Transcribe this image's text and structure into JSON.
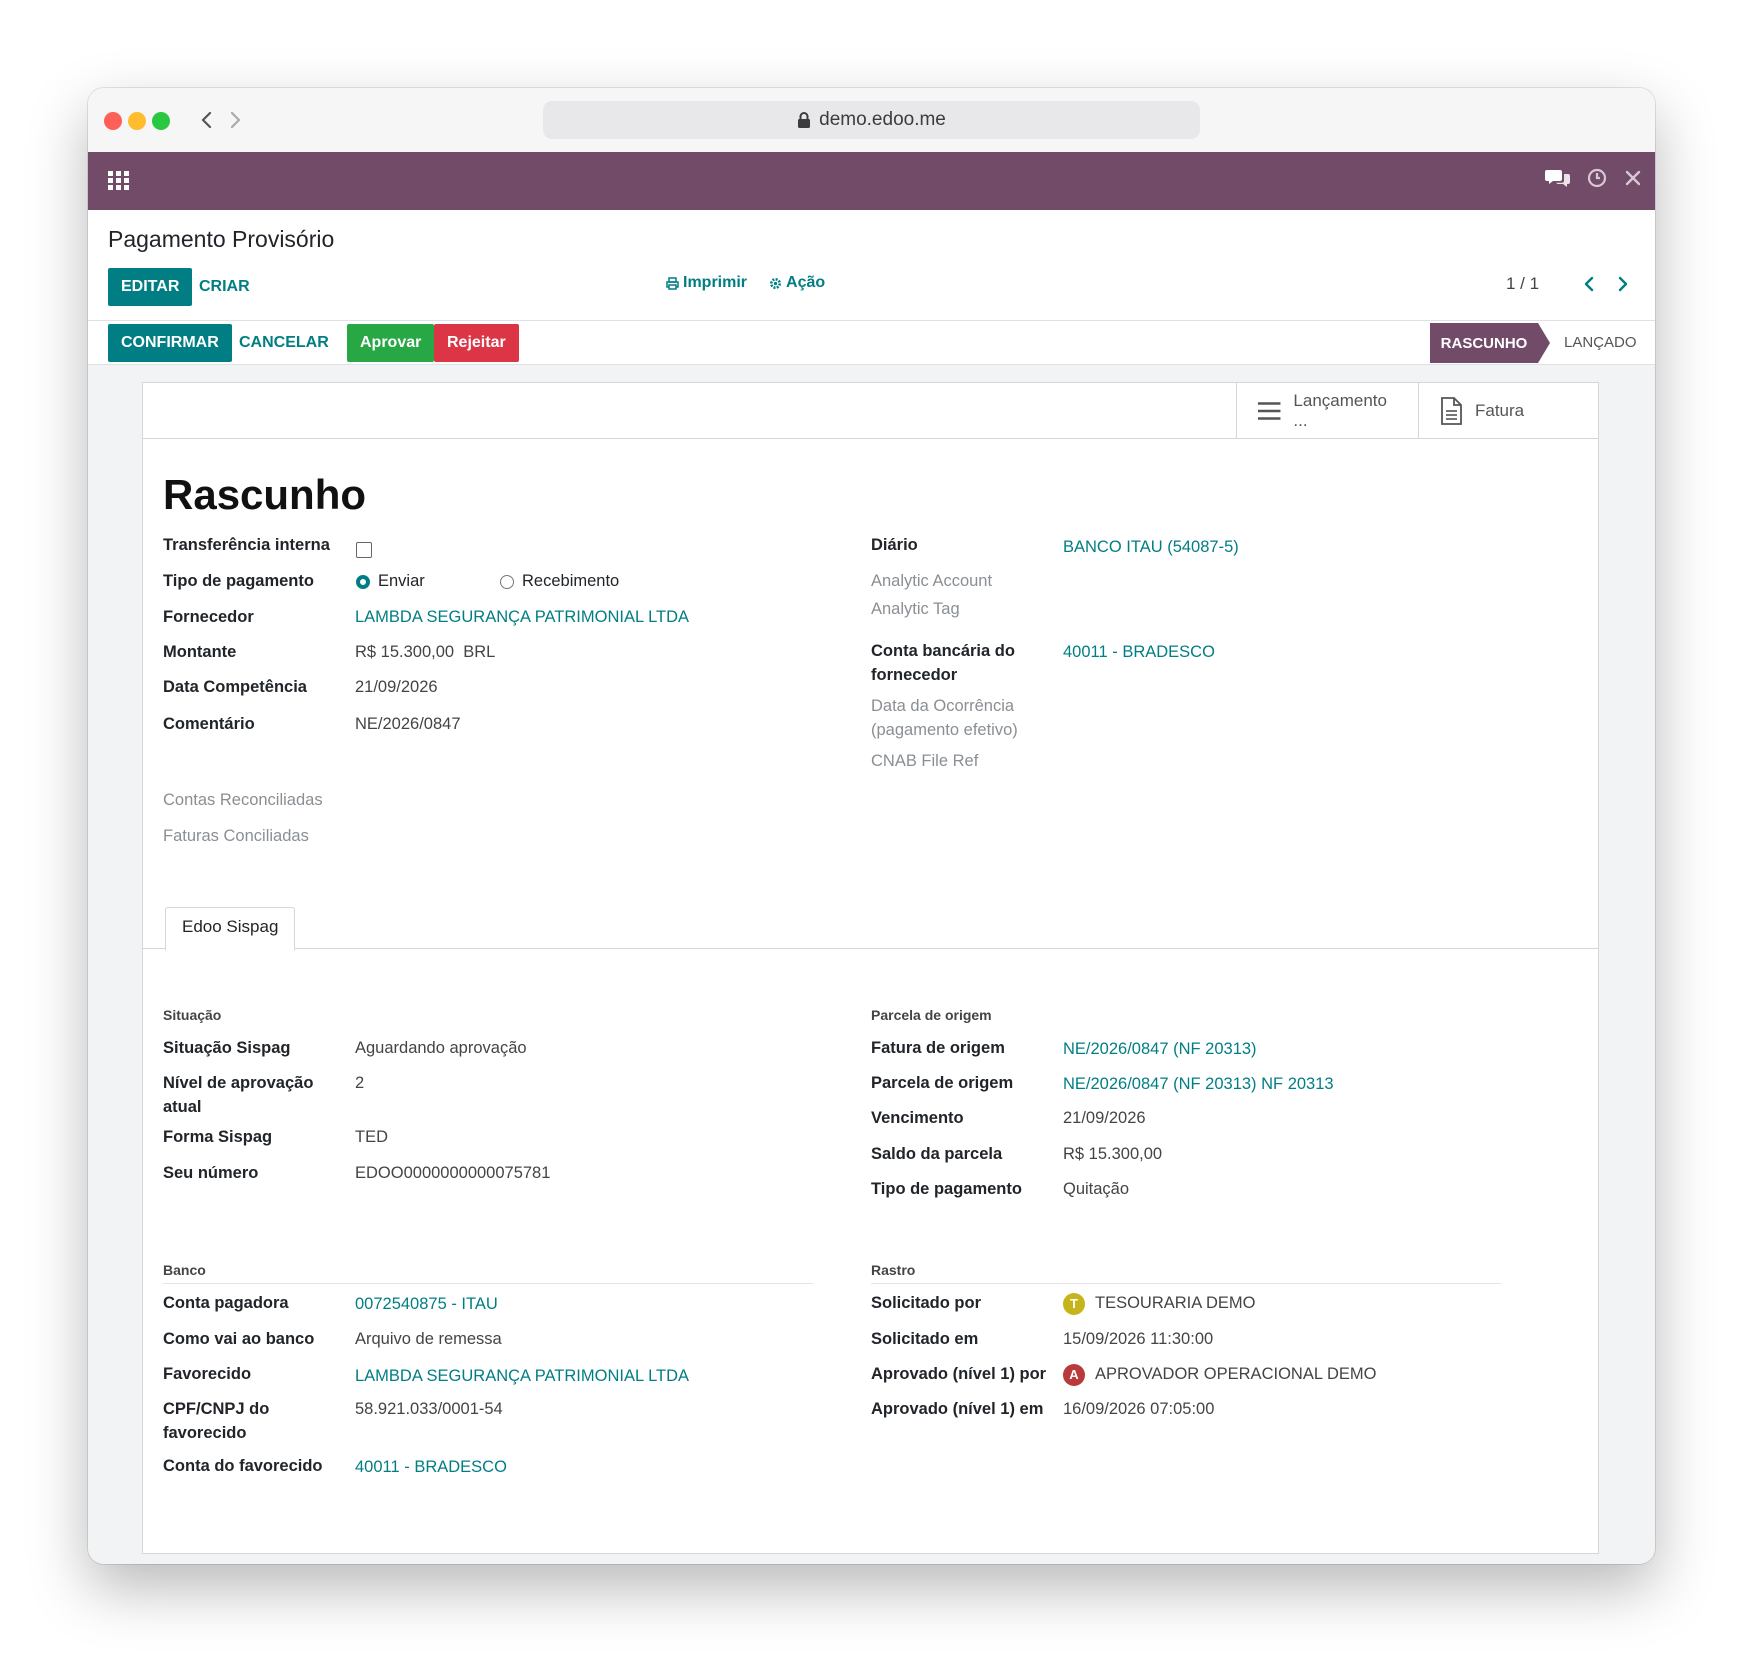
{
  "browser": {
    "url": "demo.edoo.me"
  },
  "app": {
    "breadcrumb": "Pagamento Provisório"
  },
  "toolbar": {
    "edit": "EDITAR",
    "create": "CRIAR",
    "print": "Imprimir",
    "action": "Ação",
    "pager": "1 / 1"
  },
  "header_buttons": {
    "confirm": "CONFIRMAR",
    "cancel": "CANCELAR",
    "approve": "Aprovar",
    "reject": "Rejeitar"
  },
  "statusbar": {
    "current": "RASCUNHO",
    "next": "LANÇADO"
  },
  "smart_buttons": {
    "journal_entry": "Lançamento ...",
    "invoice": "Fatura"
  },
  "form": {
    "state_title": "Rascunho",
    "left": {
      "internal_transfer_label": "Transferência interna",
      "internal_transfer_checked": false,
      "payment_type_label": "Tipo de pagamento",
      "payment_type_send": "Enviar",
      "payment_type_receive": "Recebimento",
      "payment_type_selected": "Enviar",
      "supplier_label": "Fornecedor",
      "supplier": "LAMBDA SEGURANÇA PATRIMONIAL LTDA",
      "amount_label": "Montante",
      "amount": "R$ 15.300,00",
      "currency": "BRL",
      "date_label": "Data Competência",
      "date": "21/09/2026",
      "comment_label": "Comentário",
      "comment": "NE/2026/0847",
      "reconciled_accounts_label": "Contas Reconciliadas",
      "reconciled_invoices_label": "Faturas Conciliadas"
    },
    "right": {
      "journal_label": "Diário",
      "journal": "BANCO ITAU (54087-5)",
      "analytic_account_label": "Analytic Account",
      "analytic_tag_label": "Analytic Tag",
      "supplier_bank_label_1": "Conta bancária do",
      "supplier_bank_label_2": "fornecedor",
      "supplier_bank": "40011 - BRADESCO",
      "occurrence_date_label_1": "Data da Ocorrência",
      "occurrence_date_label_2": "(pagamento efetivo)",
      "cnab_label": "CNAB File Ref"
    }
  },
  "tabs": [
    "Edoo Sispag"
  ],
  "sispag": {
    "situacao": {
      "title": "Situação",
      "status_label": "Situação Sispag",
      "status": "Aguardando aprovação",
      "level_label_1": "Nível de aprovação",
      "level_label_2": "atual",
      "level": "2",
      "form_label": "Forma Sispag",
      "form": "TED",
      "our_number_label": "Seu número",
      "our_number": "EDOO0000000000075781"
    },
    "parcela": {
      "title": "Parcela de origem",
      "invoice_label": "Fatura de origem",
      "invoice": "NE/2026/0847 (NF 20313)",
      "installment_label": "Parcela de origem",
      "installment": "NE/2026/0847 (NF 20313) NF 20313",
      "due_label": "Vencimento",
      "due": "21/09/2026",
      "balance_label": "Saldo da parcela",
      "balance": "R$ 15.300,00",
      "payment_type_label": "Tipo de pagamento",
      "payment_type": "Quitação"
    },
    "banco": {
      "title": "Banco",
      "paying_account_label": "Conta pagadora",
      "paying_account": "0072540875 - ITAU",
      "how_label": "Como vai ao banco",
      "how": "Arquivo de remessa",
      "payee_label": "Favorecido",
      "payee": "LAMBDA SEGURANÇA PATRIMONIAL LTDA",
      "payee_doc_label_1": "CPF/CNPJ do",
      "payee_doc_label_2": "favorecido",
      "payee_doc": "58.921.033/0001-54",
      "payee_account_label": "Conta do favorecido",
      "payee_account": "40011 - BRADESCO"
    },
    "rastro": {
      "title": "Rastro",
      "requested_by_label": "Solicitado por",
      "requested_by_initial": "T",
      "requested_by": "TESOURARIA DEMO",
      "requested_at_label": "Solicitado em",
      "requested_at": "15/09/2026 11:30:00",
      "approved_by_label": "Aprovado (nível 1) por",
      "approved_by_initial": "A",
      "approved_by": "APROVADOR OPERACIONAL DEMO",
      "approved_at_label": "Aprovado (nível 1) em",
      "approved_at": "16/09/2026 07:05:00"
    }
  },
  "colors": {
    "brand": "#714b67",
    "primary": "#017e84",
    "success": "#28a745",
    "danger": "#dc3545",
    "avatar_t": "#c5b41a",
    "avatar_a": "#b83a3a"
  }
}
